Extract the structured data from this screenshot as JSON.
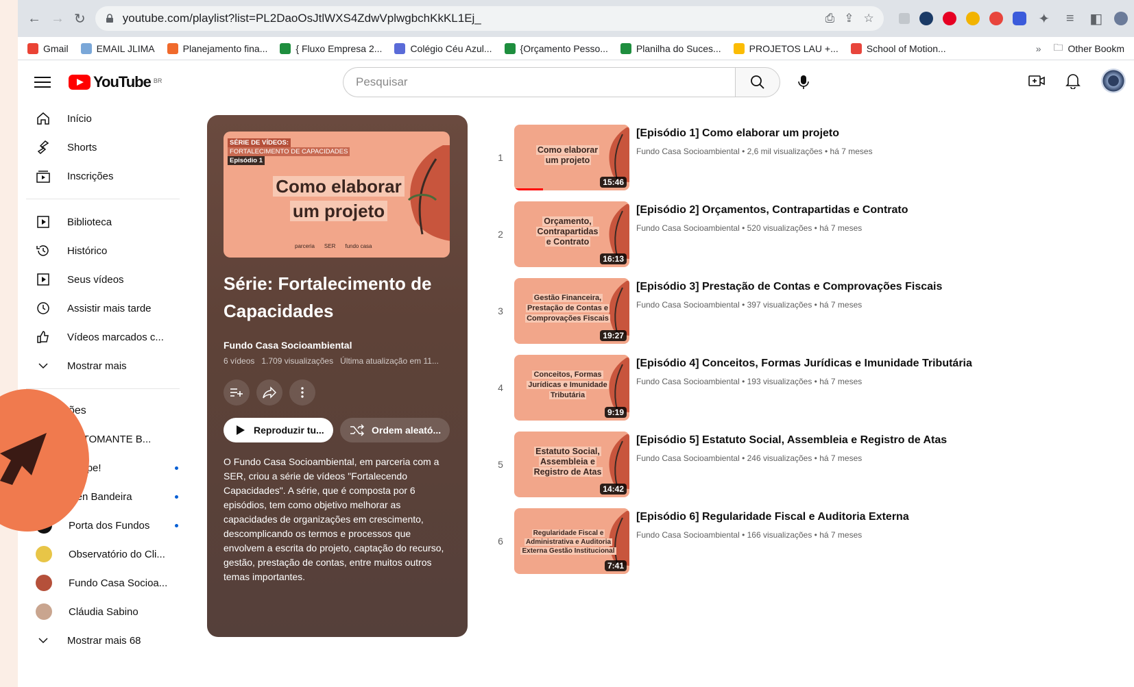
{
  "browser": {
    "url": "youtube.com/playlist?list=PL2DaoOsJtlWXS4ZdwVplwgbchKkKL1Ej_",
    "bookmarks": [
      {
        "label": "Gmail",
        "color": "#ea4335"
      },
      {
        "label": "EMAIL JLIMA",
        "color": "#7aa7d8"
      },
      {
        "label": "Planejamento fina...",
        "color": "#f06a2c"
      },
      {
        "label": "{ Fluxo Empresa 2...",
        "color": "#1e8e3e"
      },
      {
        "label": "Colégio Céu Azul...",
        "color": "#5a6bd8"
      },
      {
        "label": "{Orçamento Pesso...",
        "color": "#1e8e3e"
      },
      {
        "label": "Planilha do Suces...",
        "color": "#1e8e3e"
      },
      {
        "label": "PROJETOS LAU +...",
        "color": "#fbbc04"
      },
      {
        "label": "School of Motion...",
        "color": "#e8453c"
      }
    ],
    "more_label": "»",
    "other_bookmarks": "Other Bookm"
  },
  "header": {
    "logo_text": "YouTube",
    "country": "BR",
    "search_placeholder": "Pesquisar"
  },
  "sidebar": {
    "main": [
      {
        "label": "Início",
        "icon": "home-icon"
      },
      {
        "label": "Shorts",
        "icon": "shorts-icon"
      },
      {
        "label": "Inscrições",
        "icon": "subscriptions-icon"
      }
    ],
    "library": [
      {
        "label": "Biblioteca",
        "icon": "library-icon"
      },
      {
        "label": "Histórico",
        "icon": "history-icon"
      },
      {
        "label": "Seus vídeos",
        "icon": "your-videos-icon"
      },
      {
        "label": "Assistir mais tarde",
        "icon": "watch-later-icon"
      },
      {
        "label": "Vídeos marcados c...",
        "icon": "liked-icon"
      },
      {
        "label": "Mostrar mais",
        "icon": "chevron-down-icon"
      }
    ],
    "section_title": "ões",
    "subscriptions": [
      {
        "label": "ARTOMANTE B...",
        "dot": false,
        "color": "#333"
      },
      {
        "label": "Poupe!",
        "dot": true,
        "color": "#f2c200"
      },
      {
        "label": "alen Bandeira",
        "dot": true,
        "color": "#555"
      },
      {
        "label": "Porta dos Fundos",
        "dot": true,
        "color": "#111"
      },
      {
        "label": "Observatório do Cli...",
        "dot": false,
        "color": "#e8c547"
      },
      {
        "label": "Fundo Casa Socioa...",
        "dot": false,
        "color": "#b5503a"
      },
      {
        "label": "Cláudia Sabino",
        "dot": false,
        "color": "#c9a58f"
      }
    ],
    "show_more": "Mostrar mais 68"
  },
  "playlist": {
    "thumb": {
      "tag1": "SÉRIE DE VÍDEOS:",
      "tag2": "FORTALECIMENTO DE CAPACIDADES",
      "tag3": "Episódio 1",
      "line1": "Como elaborar",
      "line2": "um projeto",
      "foot_left": "parceria",
      "foot_mid": "SER",
      "foot_right": "fundo casa"
    },
    "title": "Série: Fortalecimento de Capacidades",
    "author": "Fundo Casa Socioambiental",
    "videos": "6 vídeos",
    "views": "1.709 visualizações",
    "updated": "Última atualização em 11...",
    "play_label": "Reproduzir tu...",
    "shuffle_label": "Ordem aleató...",
    "description": "O Fundo Casa Socioambiental, em parceria com a SER, criou a série de vídeos \"Fortalecendo Capacidades\". A série, que é composta por 6 episódios, tem como objetivo melhorar as capacidades de organizações em crescimento, descomplicando os termos e processos que envolvem a escrita do projeto, captação do recurso, gestão, prestação de contas, entre muitos outros temas importantes."
  },
  "videos": [
    {
      "index": "1",
      "title": "[Episódio 1] Como elaborar um projeto",
      "meta": "Fundo Casa Socioambiental • 2,6 mil visualizações • há 7 meses",
      "duration": "15:46",
      "thumb": [
        "Como elaborar",
        "um projeto"
      ],
      "progress": 0.25
    },
    {
      "index": "2",
      "title": "[Episódio 2] Orçamentos, Contrapartidas e Contrato",
      "meta": "Fundo Casa Socioambiental • 520 visualizações • há 7 meses",
      "duration": "16:13",
      "thumb": [
        "Orçamento,",
        "Contrapartidas",
        "e Contrato"
      ],
      "progress": 0
    },
    {
      "index": "3",
      "title": "[Episódio 3] Prestação de Contas e Comprovações Fiscais",
      "meta": "Fundo Casa Socioambiental • 397 visualizações • há 7 meses",
      "duration": "19:27",
      "thumb": [
        "Gestão Financeira,",
        "Prestação de Contas e",
        "Comprovações Fiscais"
      ],
      "progress": 0
    },
    {
      "index": "4",
      "title": "[Episódio 4] Conceitos, Formas Jurídicas e Imunidade Tributária",
      "meta": "Fundo Casa Socioambiental • 193 visualizações • há 7 meses",
      "duration": "9:19",
      "thumb": [
        "Conceitos, Formas",
        "Jurídicas e Imunidade",
        "Tributária"
      ],
      "progress": 0
    },
    {
      "index": "5",
      "title": "[Episódio 5] Estatuto Social, Assembleia e Registro de Atas",
      "meta": "Fundo Casa Socioambiental • 246 visualizações • há 7 meses",
      "duration": "14:42",
      "thumb": [
        "Estatuto Social,",
        "Assembleia e",
        "Registro de Atas"
      ],
      "progress": 0
    },
    {
      "index": "6",
      "title": "[Episódio 6] Regularidade Fiscal e Auditoria Externa",
      "meta": "Fundo Casa Socioambiental • 166 visualizações • há 7 meses",
      "duration": "7:41",
      "thumb": [
        "Regularidade Fiscal e",
        "Administrativa e Auditoria",
        "Externa Gestão Institucional"
      ],
      "progress": 0
    }
  ]
}
